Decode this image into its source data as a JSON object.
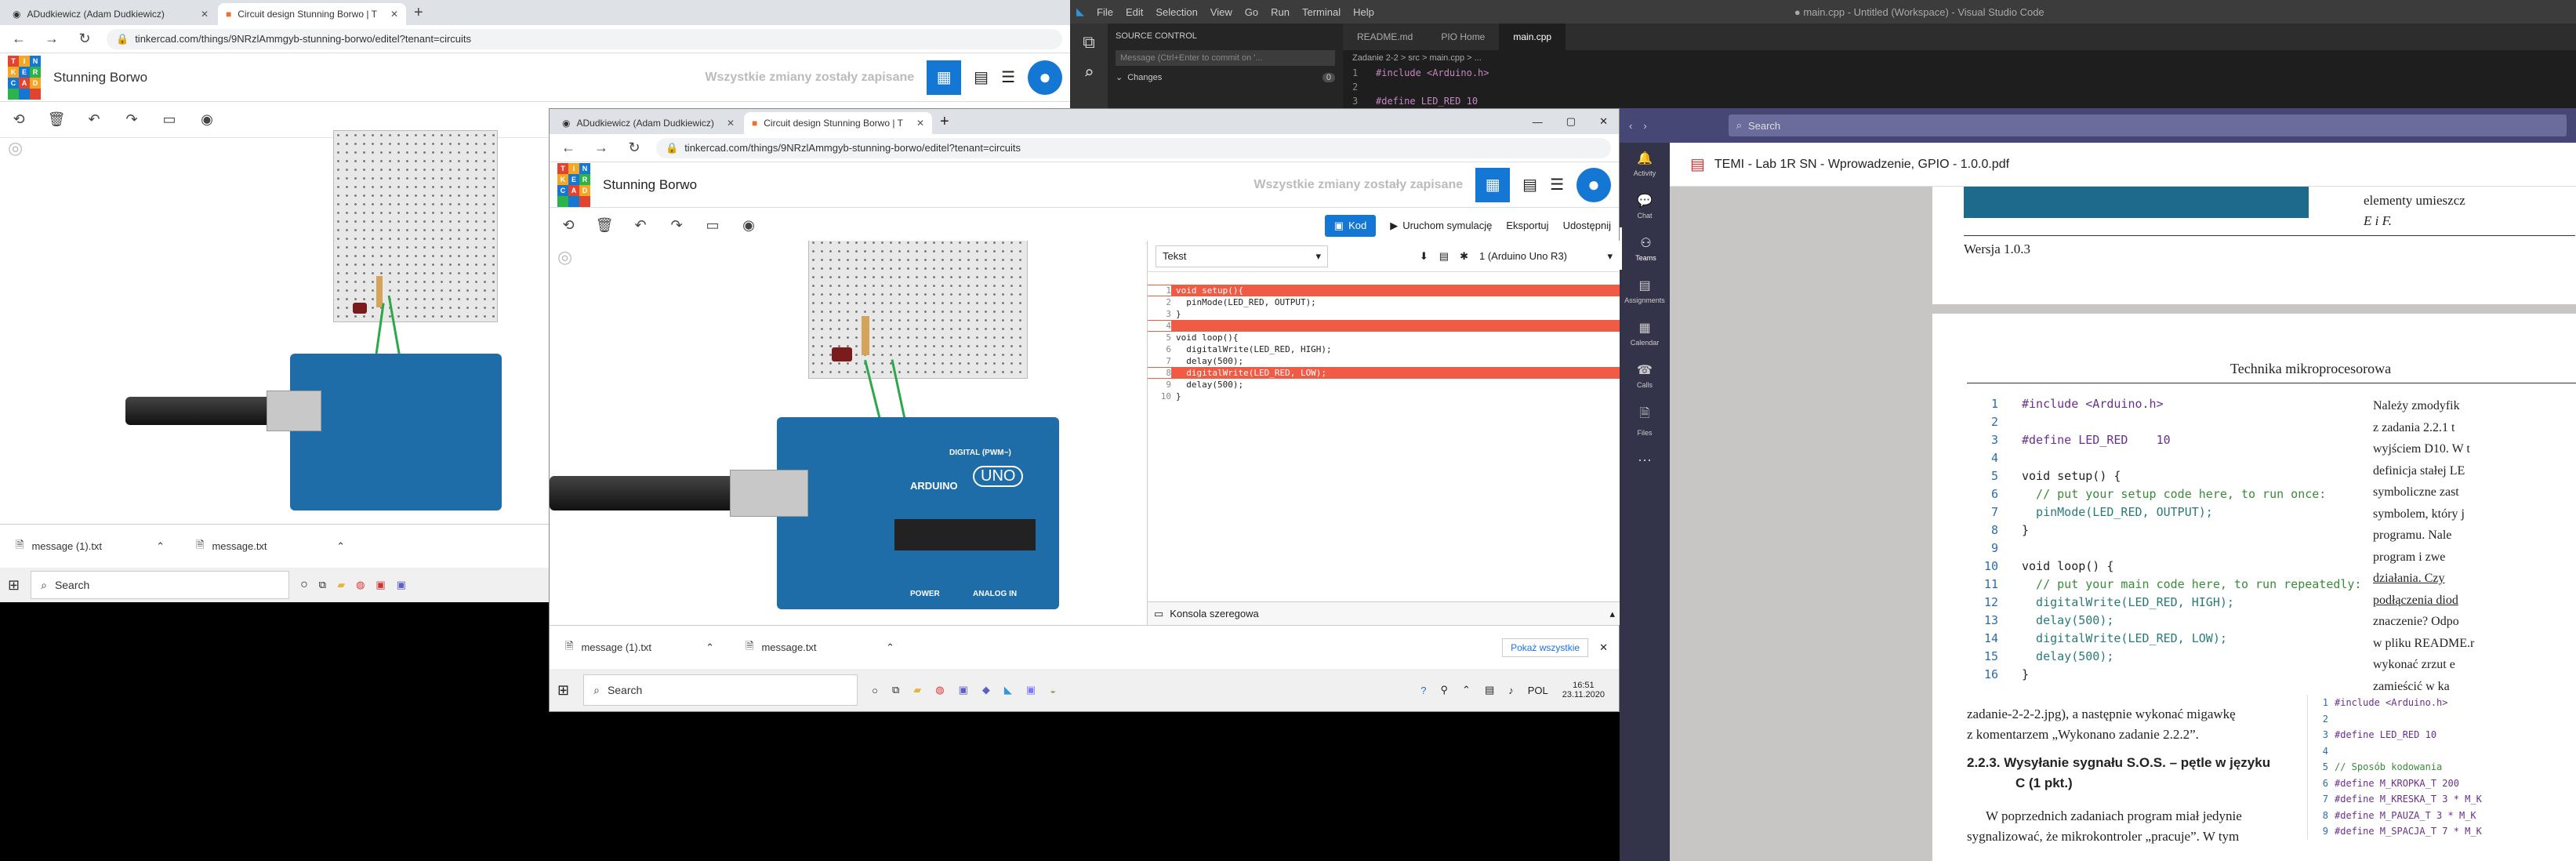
{
  "left_browser": {
    "tabs": [
      {
        "label": "ADudkiewicz (Adam Dudkiewicz)"
      },
      {
        "label": "Circuit design Stunning Borwo | T"
      }
    ],
    "url": "tinkercad.com/things/9NRzlAmmgyb-stunning-borwo/editel?tenant=circuits",
    "logo_letters": [
      "TIN",
      "KER",
      "CAD"
    ],
    "project_title": "Stunning Borwo",
    "saved_status": "Wszystkie zmiany zostały zapisane",
    "downloads": [
      "message (1).txt",
      "message.txt"
    ]
  },
  "left_taskbar": {
    "search": "Search"
  },
  "mid_browser": {
    "tabs": [
      {
        "label": "ADudkiewicz (Adam Dudkiewicz)"
      },
      {
        "label": "Circuit design Stunning Borwo | T"
      }
    ],
    "url": "tinkercad.com/things/9NRzlAmmgyb-stunning-borwo/editel?tenant=circuits",
    "project_title": "Stunning Borwo",
    "saved_status": "Wszystkie zmiany zostały zapisane",
    "toolbar": {
      "code": "Kod",
      "simulate": "Uruchom symulację",
      "export": "Eksportuj",
      "share": "Udostępnij"
    },
    "code_panel": {
      "mode": "Tekst",
      "device": "1 (Arduino Uno R3)",
      "lines": [
        {
          "n": "1",
          "text": "void setup(){",
          "err": true
        },
        {
          "n": "2",
          "text": "  pinMode(LED_RED, OUTPUT);",
          "err": false
        },
        {
          "n": "3",
          "text": "}",
          "err": false
        },
        {
          "n": "4",
          "text": "",
          "err": true
        },
        {
          "n": "5",
          "text": "void loop(){",
          "err": false
        },
        {
          "n": "6",
          "text": "  digitalWrite(LED_RED, HIGH);",
          "err": false
        },
        {
          "n": "7",
          "text": "  delay(500);",
          "err": false
        },
        {
          "n": "8",
          "text": "  digitalWrite(LED_RED, LOW);",
          "err": true
        },
        {
          "n": "9",
          "text": "  delay(500);",
          "err": false
        },
        {
          "n": "10",
          "text": "}",
          "err": false
        }
      ],
      "serial_console": "Konsola szeregowa"
    },
    "arduino_labels": {
      "brand": "ARDUINO",
      "model": "UNO",
      "digital": "DIGITAL (PWM~)",
      "power": "POWER",
      "analog": "ANALOG IN"
    },
    "downloads": [
      "message (1).txt",
      "message.txt"
    ],
    "show_all": "Pokaż wszystkie"
  },
  "mid_taskbar": {
    "search": "Search",
    "lang": "POL",
    "time": "16:51",
    "date": "23.11.2020"
  },
  "vscode": {
    "menu": [
      "File",
      "Edit",
      "Selection",
      "View",
      "Go",
      "Run",
      "Terminal",
      "Help"
    ],
    "title": "● main.cpp - Untitled (Workspace) - Visual Studio Code",
    "source_control": "SOURCE CONTROL",
    "commit_placeholder": "Message (Ctrl+Enter to commit on '...",
    "changes": "Changes",
    "changes_count": "0",
    "tabs": [
      "README.md",
      "PIO Home",
      "main.cpp"
    ],
    "breadcrumb": "Zadanie 2-2 > src > main.cpp > ...",
    "lines": [
      {
        "n": "1",
        "text": "#include <Arduino.h>"
      },
      {
        "n": "2",
        "text": ""
      },
      {
        "n": "3",
        "text": "#define LED_RED 10"
      }
    ]
  },
  "teams": {
    "search": "Search",
    "rail": [
      "Activity",
      "Chat",
      "Teams",
      "Assignments",
      "Calendar",
      "Calls",
      "Files"
    ],
    "doc_title": "TEMI - Lab 1R SN - Wprowadzenie, GPIO - 1.0.0.pdf",
    "frag_top": "elementy umieszcz",
    "frag_top2": "E i F.",
    "version": "Wersja 1.0.3",
    "page_header": "Technika mikroprocesorowa",
    "code": [
      {
        "n": "1",
        "t": "#include <Arduino.h>"
      },
      {
        "n": "2",
        "t": ""
      },
      {
        "n": "3",
        "t": "#define LED_RED    10"
      },
      {
        "n": "4",
        "t": ""
      },
      {
        "n": "5",
        "t": "void setup() {"
      },
      {
        "n": "6",
        "t": "  // put your setup code here, to run once:"
      },
      {
        "n": "7",
        "t": "  pinMode(LED_RED, OUTPUT);"
      },
      {
        "n": "8",
        "t": "}"
      },
      {
        "n": "9",
        "t": ""
      },
      {
        "n": "10",
        "t": "void loop() {"
      },
      {
        "n": "11",
        "t": "  // put your main code here, to run repeatedly:"
      },
      {
        "n": "12",
        "t": "  digitalWrite(LED_RED, HIGH);"
      },
      {
        "n": "13",
        "t": "  delay(500);"
      },
      {
        "n": "14",
        "t": "  digitalWrite(LED_RED, LOW);"
      },
      {
        "n": "15",
        "t": "  delay(500);"
      },
      {
        "n": "16",
        "t": "}"
      }
    ],
    "side_text": [
      "Należy   zmodyfik",
      "z zadania   2.2.1  t",
      "wyjściem D10. W t",
      "definicja  stałej  LE",
      "symboliczne   zast",
      "symbolem, który j",
      "programu.   Nale",
      "program    i zwe",
      "działania.   Czy",
      "podłączenia  diod",
      "znaczenie?  Odpo",
      "w pliku README.r",
      "wykonać  zrzut  e",
      "zamieścić    w    ka"
    ],
    "para1": "zadanie-2-2-2.jpg), a następnie wykonać migawkę",
    "para2": "z komentarzem „Wykonano zadanie 2.2.2”.",
    "heading": "2.2.3.  Wysyłanie sygnału S.O.S. – pętle w języku",
    "heading2": "C (1 pkt.)",
    "para3": "W poprzednich zadaniach program miał jedynie",
    "para4": "sygnalizować, że mikrokontroler „pracuje”. W tym",
    "code2": [
      {
        "n": "1",
        "t": "#include <Arduino.h>"
      },
      {
        "n": "2",
        "t": ""
      },
      {
        "n": "3",
        "t": "#define LED_RED 10"
      },
      {
        "n": "4",
        "t": ""
      },
      {
        "n": "5",
        "t": "// Sposób kodowania"
      },
      {
        "n": "6",
        "t": "#define M_KROPKA_T 200"
      },
      {
        "n": "7",
        "t": "#define M_KRESKA_T 3 * M_K"
      },
      {
        "n": "8",
        "t": "#define M_PAUZA_T 3 * M_K"
      },
      {
        "n": "9",
        "t": "#define M_SPACJA_T 7 * M_K"
      }
    ]
  }
}
